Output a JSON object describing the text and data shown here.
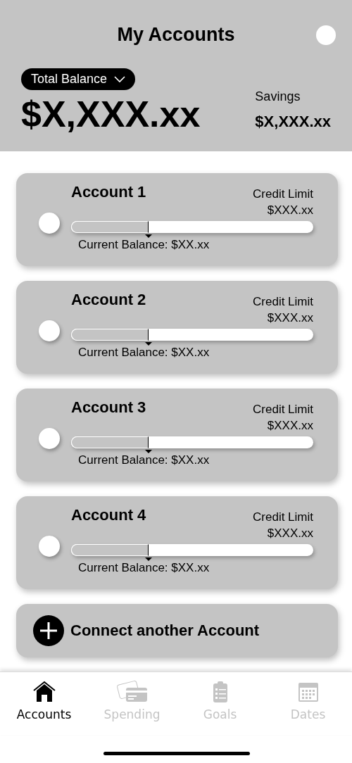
{
  "header": {
    "title": "My Accounts",
    "balance_selector": "Total Balance",
    "total": "$X,XXX.xx",
    "savings_label": "Savings",
    "savings_amount": "$X,XXX.xx"
  },
  "accounts": [
    {
      "name": "Account 1",
      "limit_label": "Credit Limit",
      "limit": "$XXX.xx",
      "level": 0.32,
      "balance": "Current Balance: $XX.xx"
    },
    {
      "name": "Account 2",
      "limit_label": "Credit Limit",
      "limit": "$XXX.xx",
      "level": 0.32,
      "balance": "Current Balance: $XX.xx"
    },
    {
      "name": "Account 3",
      "limit_label": "Credit Limit",
      "limit": "$XXX.xx",
      "level": 0.32,
      "balance": "Current Balance: $XX.xx"
    },
    {
      "name": "Account 4",
      "limit_label": "Credit Limit",
      "limit": "$XXX.xx",
      "level": 0.32,
      "balance": "Current Balance: $XX.xx"
    }
  ],
  "connect_button": "Connect another Account",
  "tabs": [
    {
      "label": "Accounts",
      "kind": "home",
      "selected": true
    },
    {
      "label": "Spending",
      "kind": "card",
      "selected": false
    },
    {
      "label": "Goals",
      "kind": "list",
      "selected": false
    },
    {
      "label": "Dates",
      "kind": "calendar",
      "selected": false
    }
  ]
}
